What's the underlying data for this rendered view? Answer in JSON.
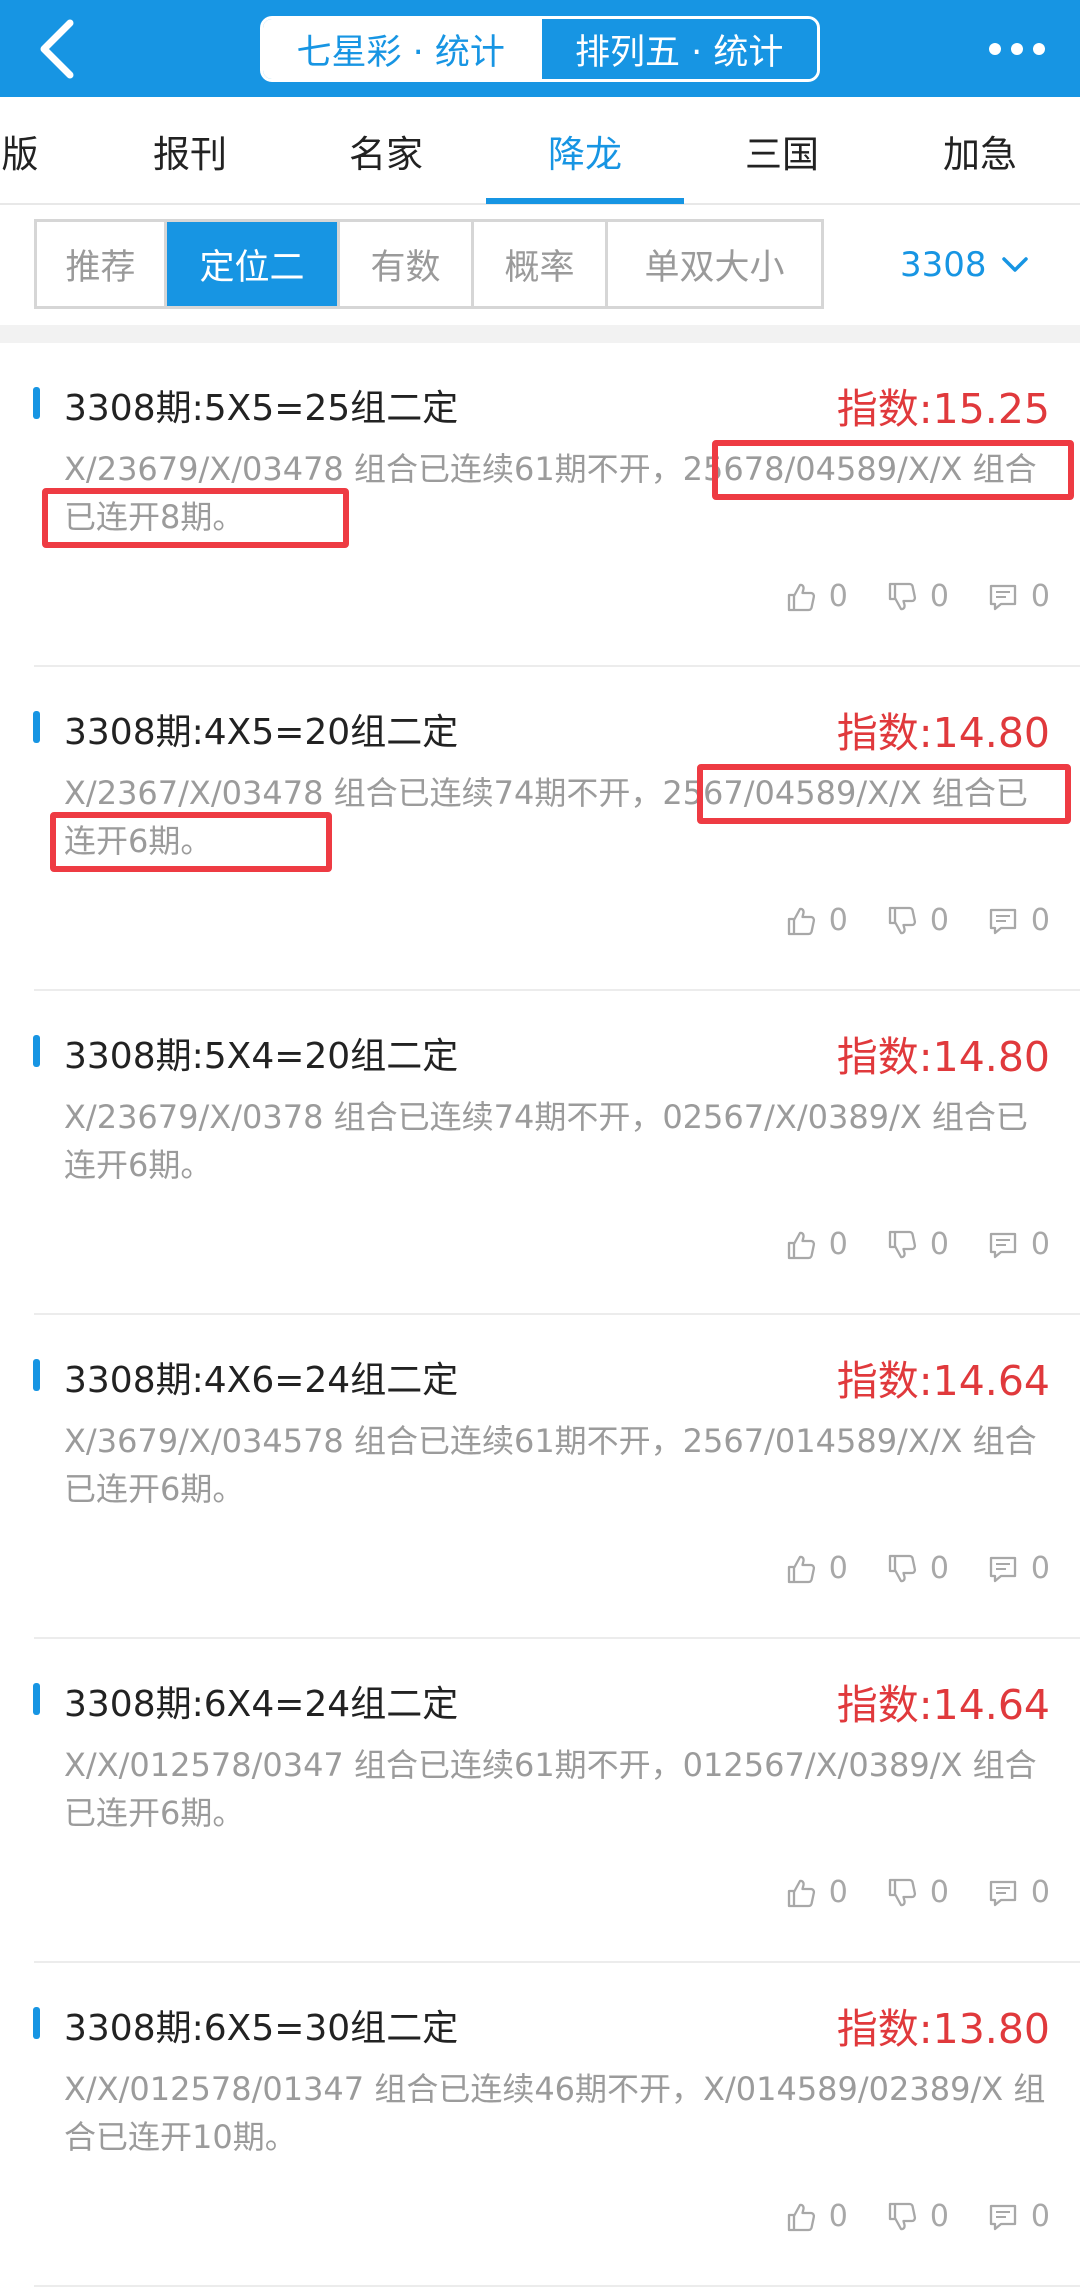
{
  "header": {
    "segments": [
      {
        "label": "七星彩 · 统计",
        "active": true
      },
      {
        "label": "排列五 · 统计",
        "active": false
      }
    ],
    "back_icon": "chevron-left-icon",
    "more_icon": "more-dots-icon"
  },
  "tabs": [
    {
      "label": "版",
      "active": false
    },
    {
      "label": "报刊",
      "active": false
    },
    {
      "label": "名家",
      "active": false
    },
    {
      "label": "降龙",
      "active": true
    },
    {
      "label": "三国",
      "active": false
    },
    {
      "label": "加急",
      "active": false
    }
  ],
  "filters": [
    {
      "label": "推荐",
      "active": false
    },
    {
      "label": "定位二",
      "active": true
    },
    {
      "label": "有数",
      "active": false
    },
    {
      "label": "概率",
      "active": false
    },
    {
      "label": "单双大小",
      "active": false
    }
  ],
  "period_select": {
    "value": "3308"
  },
  "colors": {
    "brand": "#1795e3",
    "index_red": "#e0393c",
    "highlight_box": "#ee3b43",
    "desc_gray": "#9b9b9b"
  },
  "items": [
    {
      "title": "3308期:5X5=25组二定",
      "index": "指数:15.25",
      "desc": "X/23679/X/03478 组合已连续61期不开，2567­8/04589/X/X 组合已连开8期。",
      "likes": "0",
      "dislikes": "0",
      "comments": "0"
    },
    {
      "title": "3308期:4X5=20组二定",
      "index": "指数:14.80",
      "desc": "X/2367/X/03478 组合已连续74期不开，2567/04589/X/X 组合已连开6期。",
      "likes": "0",
      "dislikes": "0",
      "comments": "0"
    },
    {
      "title": "3308期:5X4=20组二定",
      "index": "指数:14.80",
      "desc": "X/23679/X/0378 组合已连续74期不开，02567/X/0389/X 组合已连开6期。",
      "likes": "0",
      "dislikes": "0",
      "comments": "0"
    },
    {
      "title": "3308期:4X6=24组二定",
      "index": "指数:14.64",
      "desc": "X/3679/X/034578 组合已连续61期不开，2567/014589/X/X 组合已连开6期。",
      "likes": "0",
      "dislikes": "0",
      "comments": "0"
    },
    {
      "title": "3308期:6X4=24组二定",
      "index": "指数:14.64",
      "desc": "X/X/012578/0347 组合已连续61期不开，012567/X/0389/X 组合已连开6期。",
      "likes": "0",
      "dislikes": "0",
      "comments": "0"
    },
    {
      "title": "3308期:6X5=30组二定",
      "index": "指数:13.80",
      "desc": "X/X/012578/01347 组合已连续46期不开，X/014589/02389/X 组合已连开10期。",
      "likes": "0",
      "dislikes": "0",
      "comments": "0"
    }
  ]
}
